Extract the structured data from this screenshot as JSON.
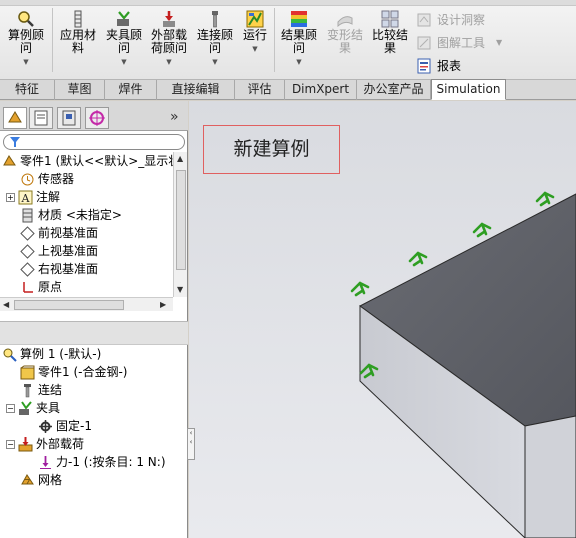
{
  "ribbon": {
    "buttons": [
      {
        "id": "study",
        "label": "算例顾\n问",
        "icon": "study-advisor-icon",
        "disabled": false
      },
      {
        "id": "material",
        "label": "应用材\n料",
        "icon": "apply-material-icon",
        "disabled": false
      },
      {
        "id": "fixtures",
        "label": "夹具顾\n问",
        "icon": "fixtures-advisor-icon",
        "disabled": false
      },
      {
        "id": "loads",
        "label": "外部载\n荷顾问",
        "icon": "external-loads-icon",
        "disabled": false
      },
      {
        "id": "connections",
        "label": "连接顾\n问",
        "icon": "connections-advisor-icon",
        "disabled": false
      },
      {
        "id": "run",
        "label": "运行",
        "icon": "run-icon",
        "disabled": false
      },
      {
        "id": "results",
        "label": "结果顾\n问",
        "icon": "results-advisor-icon",
        "disabled": false
      },
      {
        "id": "deformed",
        "label": "变形结\n果",
        "icon": "deformed-result-icon",
        "disabled": true
      },
      {
        "id": "compare",
        "label": "比较结\n果",
        "icon": "compare-results-icon",
        "disabled": false
      }
    ],
    "small_buttons": [
      {
        "id": "design-insight",
        "label": "设计洞察",
        "icon": "design-insight-icon",
        "disabled": true
      },
      {
        "id": "plot-tools",
        "label": "图解工具",
        "icon": "plot-tools-icon",
        "disabled": true
      },
      {
        "id": "report",
        "label": "报表",
        "icon": "report-icon",
        "disabled": false
      }
    ]
  },
  "tabs": [
    {
      "label": "特征",
      "active": false
    },
    {
      "label": "草图",
      "active": false
    },
    {
      "label": "焊件",
      "active": false
    },
    {
      "label": "直接编辑",
      "active": false
    },
    {
      "label": "评估",
      "active": false
    },
    {
      "label": "DimXpert",
      "active": false
    },
    {
      "label": "办公室产品",
      "active": false
    },
    {
      "label": "Simulation",
      "active": true
    }
  ],
  "feature_tree": {
    "root_label": "零件1  (默认<<默认>_显示状",
    "items": [
      {
        "label": "传感器",
        "icon": "sensor-icon"
      },
      {
        "label": "注解",
        "icon": "annotation-icon"
      },
      {
        "label": "材质 <未指定>",
        "icon": "material-icon"
      },
      {
        "label": "前视基准面",
        "icon": "plane-icon"
      },
      {
        "label": "上视基准面",
        "icon": "plane-icon"
      },
      {
        "label": "右视基准面",
        "icon": "plane-icon"
      },
      {
        "label": "原点",
        "icon": "origin-icon"
      }
    ]
  },
  "study_tree": {
    "root_label": "算例 1 (-默认-)",
    "items": [
      {
        "label": "零件1 (-合金钢-)",
        "icon": "part-icon"
      },
      {
        "label": "连结",
        "icon": "connections-icon"
      },
      {
        "label": "夹具",
        "icon": "fixtures-icon"
      },
      {
        "label": "固定-1",
        "icon": "fixed-geometry-icon"
      },
      {
        "label": "外部载荷",
        "icon": "external-loads-icon"
      },
      {
        "label": "力-1 (:按条目: 1 N:)",
        "icon": "force-icon"
      },
      {
        "label": "网格",
        "icon": "mesh-icon"
      }
    ]
  },
  "graphics": {
    "note_text": "新建算例"
  },
  "colors": {
    "fixture_green": "#2e9e22",
    "model_face_top": "#5f6168",
    "model_face_side": "#c6c8cf",
    "note_border": "#e06060"
  }
}
